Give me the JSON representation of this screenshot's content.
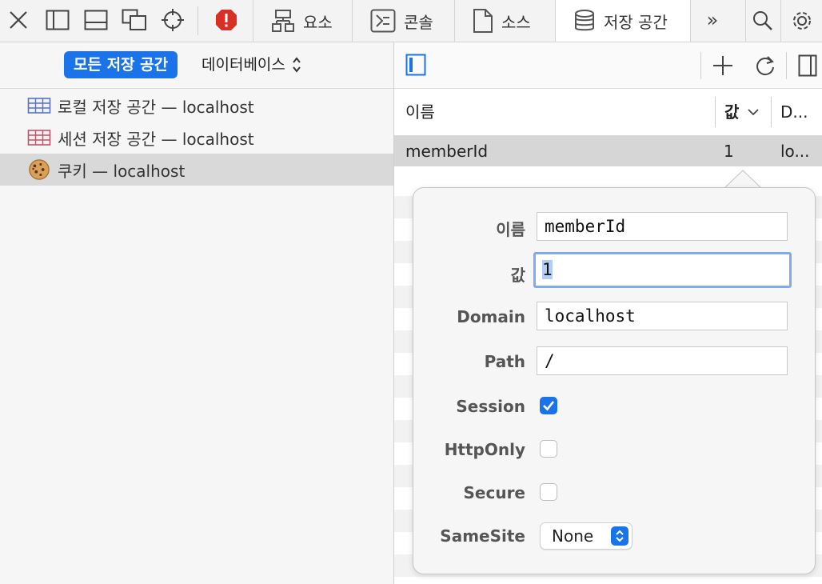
{
  "toolbar": {
    "icons": [
      "close-icon",
      "sidebar-left-icon",
      "dock-bottom-icon",
      "detach-window-icon",
      "target-icon",
      "error-icon"
    ],
    "tabs": [
      {
        "label": "요소",
        "icon": "elements-icon",
        "active": false
      },
      {
        "label": "콘솔",
        "icon": "console-icon",
        "active": false
      },
      {
        "label": "소스",
        "icon": "sources-icon",
        "active": false
      },
      {
        "label": "저장 공간",
        "icon": "storage-icon",
        "active": true
      }
    ],
    "more": "»",
    "error_color": "#d93025"
  },
  "left": {
    "filter_pill": "모든 저장 공간",
    "db_select": "데이터베이스",
    "items": [
      {
        "label": "로컬 저장 공간 — localhost",
        "icon": "table-blue-icon",
        "selected": false
      },
      {
        "label": "세션 저장 공간 — localhost",
        "icon": "table-red-icon",
        "selected": false
      },
      {
        "label": "쿠키 — localhost",
        "icon": "cookie-icon",
        "selected": true
      }
    ]
  },
  "right": {
    "columns": {
      "name": "이름",
      "value": "값",
      "domain": "D..."
    },
    "row": {
      "name": "memberId",
      "value": "1",
      "domain": "lo..."
    }
  },
  "popover": {
    "labels": {
      "name": "이름",
      "value": "값",
      "domain": "Domain",
      "path": "Path",
      "session": "Session",
      "httponly": "HttpOnly",
      "secure": "Secure",
      "samesite": "SameSite"
    },
    "fields": {
      "name": "memberId",
      "value": "1",
      "domain": "localhost",
      "path": "/"
    },
    "session_checked": true,
    "httponly_checked": false,
    "secure_checked": false,
    "samesite": "None"
  },
  "accent": "#1a73e8"
}
